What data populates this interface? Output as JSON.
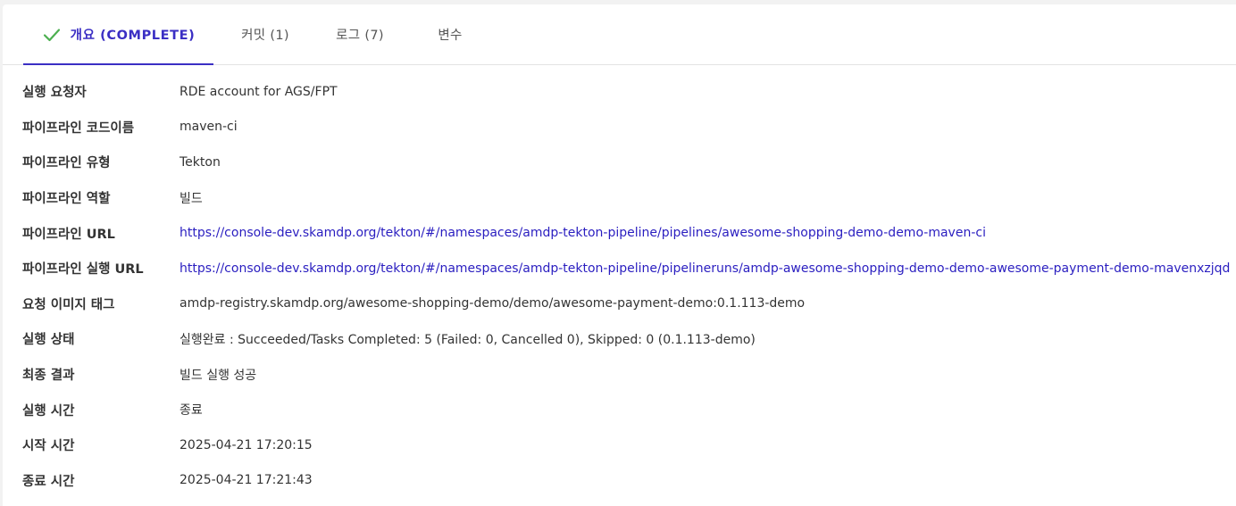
{
  "tabs": [
    {
      "label": "개요 (COMPLETE)",
      "active": true,
      "icon": "check-icon"
    },
    {
      "label": "커밋 (1)",
      "active": false
    },
    {
      "label": "로그 (7)",
      "active": false
    },
    {
      "label": "변수",
      "active": false
    }
  ],
  "colors": {
    "accent": "#3b2fc4",
    "check": "#4caf50",
    "link": "#2a1ec0"
  },
  "details": [
    {
      "label": "실행 요청자",
      "value": "RDE account for AGS/FPT"
    },
    {
      "label": "파이프라인 코드이름",
      "value": "maven-ci"
    },
    {
      "label": "파이프라인 유형",
      "value": "Tekton"
    },
    {
      "label": "파이프라인 역할",
      "value": "빌드"
    },
    {
      "label": "파이프라인 URL",
      "value": "https://console-dev.skamdp.org/tekton/#/namespaces/amdp-tekton-pipeline/pipelines/awesome-shopping-demo-demo-maven-ci"
    },
    {
      "label": "파이프라인 실행 URL",
      "value": "https://console-dev.skamdp.org/tekton/#/namespaces/amdp-tekton-pipeline/pipelineruns/amdp-awesome-shopping-demo-demo-awesome-payment-demo-mavenxzjqd"
    },
    {
      "label": "요청 이미지 태그",
      "value": "amdp-registry.skamdp.org/awesome-shopping-demo/demo/awesome-payment-demo:0.1.113-demo"
    },
    {
      "label": "실행 상태",
      "value": "실행완료 : Succeeded/Tasks Completed: 5 (Failed: 0, Cancelled 0), Skipped: 0 (0.1.113-demo)"
    },
    {
      "label": "최종 결과",
      "value": "빌드 실행 성공"
    },
    {
      "label": "실행 시간",
      "value": "종료"
    },
    {
      "label": "시작 시간",
      "value": "2025-04-21 17:20:15"
    },
    {
      "label": "종료 시간",
      "value": "2025-04-21 17:21:43"
    }
  ]
}
